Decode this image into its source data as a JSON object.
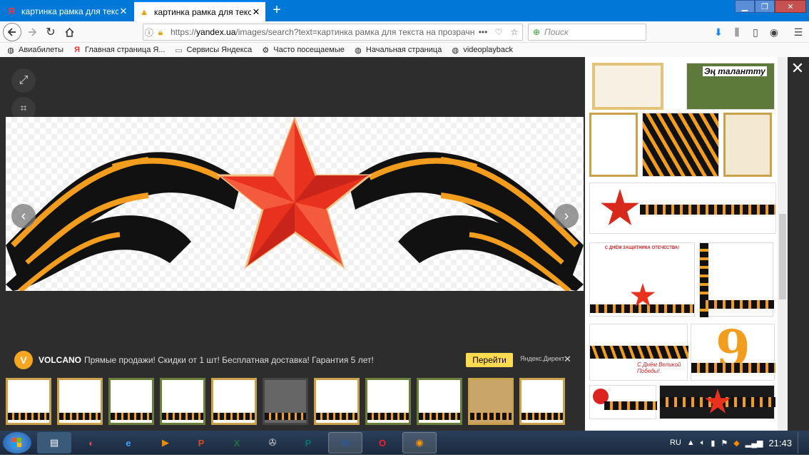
{
  "browser": {
    "tabs": [
      {
        "title": "картинка рамка для текста на п",
        "favicon": "yandex-icon",
        "active": false
      },
      {
        "title": "картинка рамка для текста на п",
        "favicon": "image-icon",
        "active": true
      }
    ],
    "url": {
      "prefix": "https://",
      "host": "yandex.ua",
      "path": "/images/search?text=картинка рамка для текста на прозрачно"
    },
    "search_placeholder": "Поиск",
    "bookmarks": [
      {
        "label": "Авиабилеты",
        "icon": "globe-icon"
      },
      {
        "label": "Главная страница Я...",
        "icon": "yandex-icon"
      },
      {
        "label": "Сервисы Яндекса",
        "icon": "folder-icon"
      },
      {
        "label": "Часто посещаемые",
        "icon": "gear-icon"
      },
      {
        "label": "Начальная страница",
        "icon": "globe-icon"
      },
      {
        "label": "videoplayback",
        "icon": "globe-icon"
      }
    ]
  },
  "viewer": {
    "ad": {
      "brand": "VOLCANO",
      "text": "Прямые продажи! Скидки от 1 шт! Бесплатная доставка! Гарантия 5 лет!",
      "button": "Перейти",
      "source": "Яндекс.Директ"
    }
  },
  "side_panel": {
    "caption_1": "Эң талантту",
    "caption_2": "С ДНЁМ ЗАЩИТНИКА ОТЕЧЕСТВА!",
    "caption_3": "9",
    "caption_4": "С Днём Великой Победы!"
  },
  "taskbar": {
    "language": "RU",
    "time": "21:43"
  },
  "colors": {
    "tabstrip": "#0078d7",
    "ribbon_orange": "#f29d1e",
    "ribbon_black": "#111111",
    "star_red": "#e8321e",
    "ad_button": "#ffdb4d"
  }
}
